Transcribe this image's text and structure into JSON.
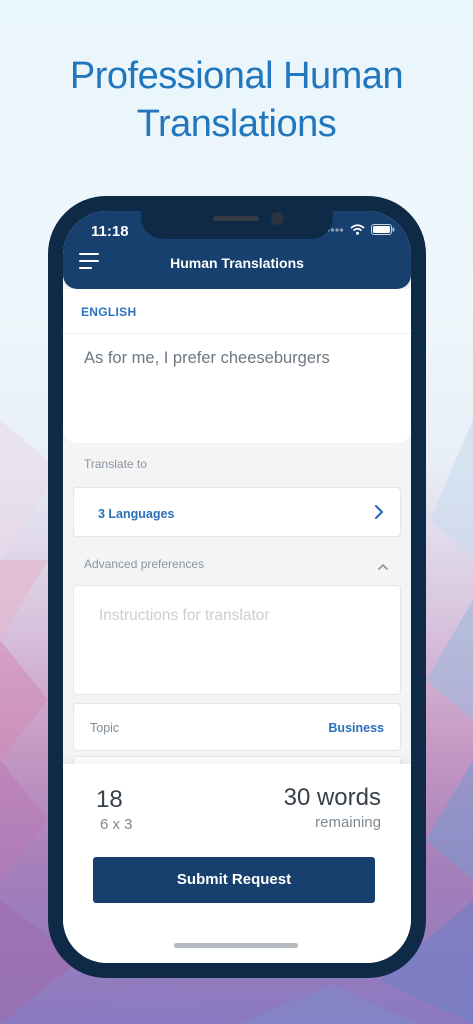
{
  "headline": {
    "line1": "Professional Human",
    "line2": "Translations"
  },
  "status_bar": {
    "time": "11:18",
    "icons": [
      "signal-icon",
      "wifi-icon",
      "battery-icon"
    ]
  },
  "navbar": {
    "title": "Human Translations",
    "menu_icon": "hamburger-menu-icon"
  },
  "source": {
    "language": "ENGLISH",
    "text": "As for me, I prefer cheeseburgers"
  },
  "translate_to": {
    "label": "Translate to",
    "value": "3 Languages",
    "icon": "chevron-right-icon"
  },
  "advanced": {
    "label": "Advanced preferences",
    "icon": "chevron-up-icon",
    "instructions_placeholder": "Instructions for translator",
    "topic_label": "Topic",
    "topic_value": "Business"
  },
  "summary": {
    "count": "18",
    "count_detail": "6 x 3",
    "words": "30 words",
    "words_detail": "remaining"
  },
  "submit_label": "Submit Request",
  "colors": {
    "brand": "#17406e",
    "accent": "#2a73bf",
    "headline": "#2176be"
  }
}
